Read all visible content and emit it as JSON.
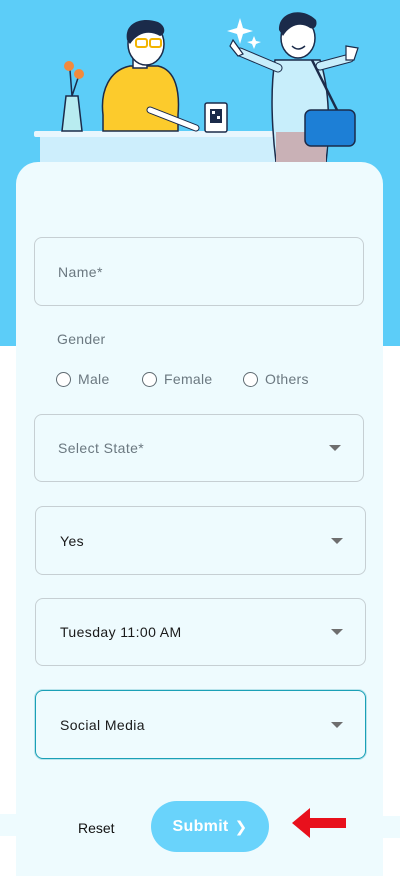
{
  "form": {
    "name_placeholder": "Name*",
    "gender_label": "Gender",
    "gender_options": [
      "Male",
      "Female",
      "Others"
    ],
    "state_placeholder": "Select State*",
    "select1_value": "Yes",
    "select2_value": "Tuesday 11:00 AM",
    "select3_value": "Social Media"
  },
  "actions": {
    "reset_label": "Reset",
    "submit_label": "Submit",
    "submit_chevron": "❯"
  },
  "colors": {
    "hero_background": "#5ccdf8",
    "card_background": "#eefbfe",
    "submit_background": "#69d3fb",
    "active_border": "#1aa0b6",
    "annotation_arrow": "#e8101c"
  },
  "icons": {
    "dropdown": "chevron-down-icon",
    "submit": "chevron-right-icon",
    "annotation": "red-arrow-icon"
  }
}
